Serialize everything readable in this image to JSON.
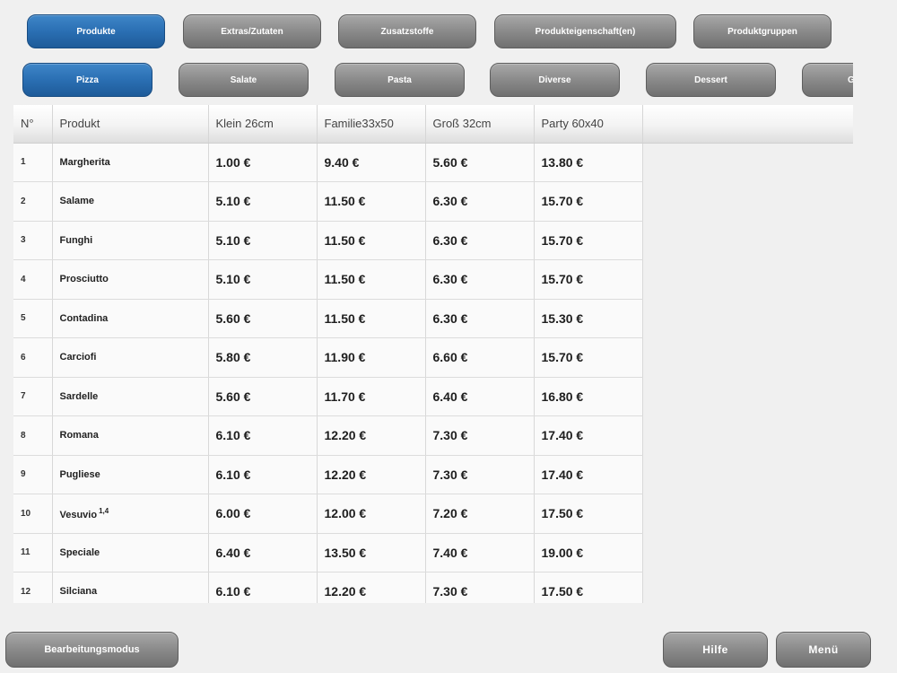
{
  "product_tabs": [
    {
      "label": "Produkte",
      "active": true
    },
    {
      "label": "Extras/Zutaten",
      "active": false
    },
    {
      "label": "Zusatzstoffe",
      "active": false
    },
    {
      "label": "Produkteigenschaft(en)",
      "active": false
    },
    {
      "label": "Produktgruppen",
      "active": false
    }
  ],
  "category_tabs": [
    {
      "label": "Pizza",
      "active": true
    },
    {
      "label": "Salate",
      "active": false
    },
    {
      "label": "Pasta",
      "active": false
    },
    {
      "label": "Diverse",
      "active": false
    },
    {
      "label": "Dessert",
      "active": false
    },
    {
      "label": "G",
      "active": false
    }
  ],
  "table": {
    "columns": [
      "N°",
      "Produkt",
      "Klein 26cm",
      "Familie33x50",
      "Groß 32cm",
      "Party 60x40"
    ],
    "rows": [
      {
        "num": "1",
        "name": "Margherita",
        "sup": "",
        "prices": [
          "1.00 €",
          "9.40 €",
          "5.60 €",
          "13.80 €"
        ]
      },
      {
        "num": "2",
        "name": "Salame",
        "sup": "",
        "prices": [
          "5.10 €",
          "11.50 €",
          "6.30 €",
          "15.70 €"
        ]
      },
      {
        "num": "3",
        "name": "Funghi",
        "sup": "",
        "prices": [
          "5.10 €",
          "11.50 €",
          "6.30 €",
          "15.70 €"
        ]
      },
      {
        "num": "4",
        "name": "Prosciutto",
        "sup": "",
        "prices": [
          "5.10 €",
          "11.50 €",
          "6.30 €",
          "15.70 €"
        ]
      },
      {
        "num": "5",
        "name": "Contadina",
        "sup": "",
        "prices": [
          "5.60 €",
          "11.50 €",
          "6.30 €",
          "15.30 €"
        ]
      },
      {
        "num": "6",
        "name": "Carciofi",
        "sup": "",
        "prices": [
          "5.80 €",
          "11.90 €",
          "6.60 €",
          "15.70 €"
        ]
      },
      {
        "num": "7",
        "name": "Sardelle",
        "sup": "",
        "prices": [
          "5.60 €",
          "11.70 €",
          "6.40 €",
          "16.80 €"
        ]
      },
      {
        "num": "8",
        "name": "Romana",
        "sup": "",
        "prices": [
          "6.10 €",
          "12.20 €",
          "7.30 €",
          "17.40 €"
        ]
      },
      {
        "num": "9",
        "name": "Pugliese",
        "sup": "",
        "prices": [
          "6.10 €",
          "12.20 €",
          "7.30 €",
          "17.40 €"
        ]
      },
      {
        "num": "10",
        "name": "Vesuvio",
        "sup": "1,4",
        "prices": [
          "6.00 €",
          "12.00 €",
          "7.20 €",
          "17.50 €"
        ]
      },
      {
        "num": "11",
        "name": "Speciale",
        "sup": "",
        "prices": [
          "6.40 €",
          "13.50 €",
          "7.40 €",
          "19.00 €"
        ]
      },
      {
        "num": "12",
        "name": "Silciana",
        "sup": "",
        "prices": [
          "6.10 €",
          "12.20 €",
          "7.30 €",
          "17.50 €"
        ]
      }
    ]
  },
  "footer": {
    "edit_mode_label": "Bearbeitungsmodus",
    "help_label": "Hilfe",
    "menu_label": "Menü"
  },
  "colors": {
    "active_tab": "#2a6fb3",
    "inactive_tab": "#8a8a8a",
    "background": "#f0f0f0"
  }
}
